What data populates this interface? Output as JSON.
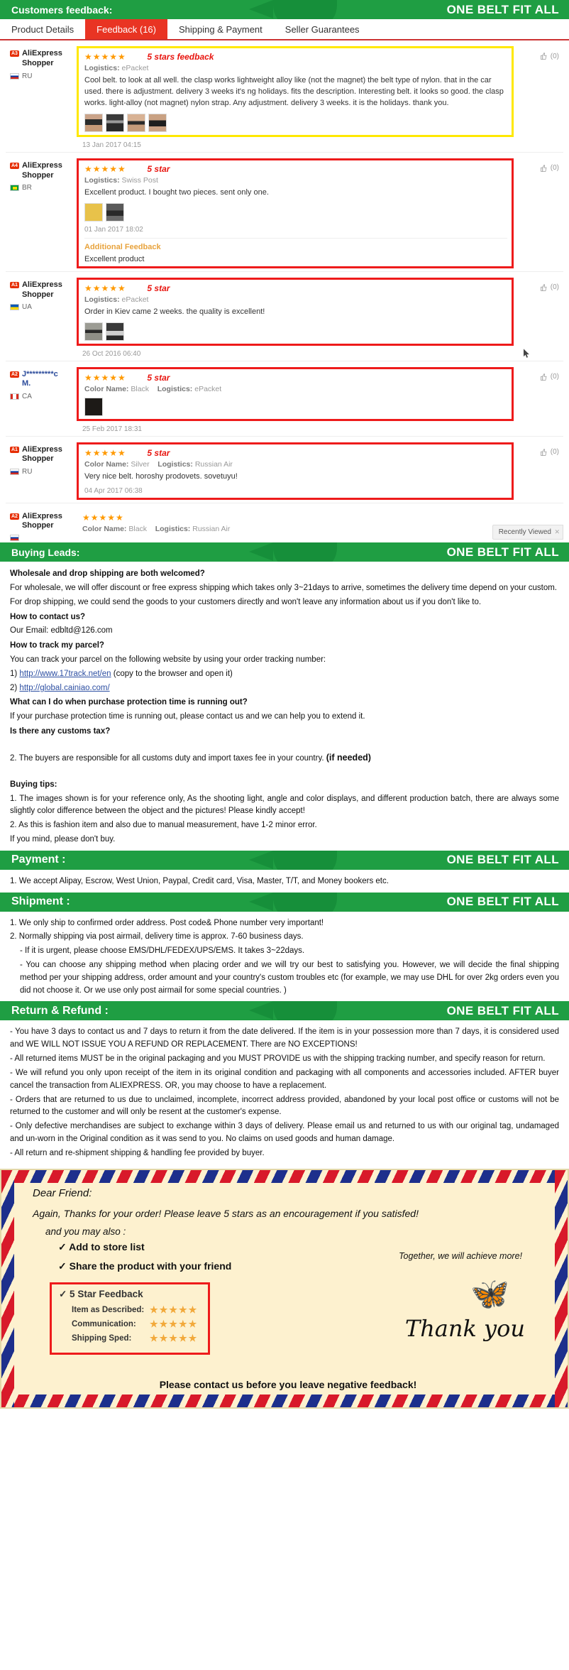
{
  "banners": {
    "customers_feedback": {
      "title": "Customers feedback:",
      "slogan": "ONE BELT FIT ALL"
    },
    "buying_leads": {
      "title": "Buying Leads:",
      "slogan": "ONE BELT FIT ALL"
    },
    "payment": {
      "title": "Payment :",
      "slogan": "ONE BELT FIT ALL"
    },
    "shipment": {
      "title": "Shipment :",
      "slogan": "ONE BELT FIT ALL"
    },
    "return_refund": {
      "title": "Return & Refund :",
      "slogan": "ONE BELT FIT ALL"
    }
  },
  "tabs": [
    {
      "label": "Product Details",
      "active": false
    },
    {
      "label": "Feedback (16)",
      "active": true
    },
    {
      "label": "Shipping & Payment",
      "active": false
    },
    {
      "label": "Seller Guarantees",
      "active": false
    }
  ],
  "recently_viewed": {
    "label": "Recently Viewed",
    "close": "✕"
  },
  "feedback": [
    {
      "badge": "A3",
      "user_line1": "AliExpress",
      "user_line2": "Shopper",
      "country": "RU",
      "flag": "ru",
      "stars": "★★★★★",
      "annotation": "5 stars feedback",
      "highlight": "yellow",
      "meta_label": "Logistics:",
      "meta_value": "ePacket",
      "color_label": "",
      "color_value": "",
      "comment": "Cool belt. to look at all well. the clasp works lightweight alloy like (not the magnet) the belt type of nylon. that in the car used. there is adjustment. delivery 3 weeks it's ng holidays. fits the description. Interesting belt. it looks so good. the clasp works. light-alloy (not magnet) nylon strap. Any adjustment. delivery 3 weeks. it is the holidays. thank you.",
      "thumbs": 4,
      "date": "13 Jan 2017 04:15",
      "helpful": "(0)",
      "additional": null
    },
    {
      "badge": "A4",
      "user_line1": "AliExpress",
      "user_line2": "Shopper",
      "country": "BR",
      "flag": "br",
      "stars": "★★★★★",
      "annotation": "5 star",
      "highlight": "red",
      "meta_label": "Logistics:",
      "meta_value": "Swiss Post",
      "color_label": "",
      "color_value": "",
      "comment": "Excellent product. I bought two pieces. sent only one.",
      "thumbs": 2,
      "date": "01 Jan 2017 18:02",
      "helpful": "(0)",
      "additional": {
        "title": "Additional Feedback",
        "text": "Excellent product"
      }
    },
    {
      "badge": "A1",
      "user_line1": "AliExpress",
      "user_line2": "Shopper",
      "country": "UA",
      "flag": "ua",
      "stars": "★★★★★",
      "annotation": "5 star",
      "highlight": "red",
      "meta_label": "Logistics:",
      "meta_value": "ePacket",
      "color_label": "",
      "color_value": "",
      "comment": "Order in Kiev came 2 weeks. the quality is excellent!",
      "thumbs": 2,
      "date": "26 Oct 2016 06:40",
      "helpful": "(0)",
      "additional": null
    },
    {
      "badge": "A2",
      "user_line1": "J*********c",
      "user_line2": "M.",
      "country": "CA",
      "flag": "ca",
      "stars": "★★★★★",
      "annotation": "5 star",
      "highlight": "red",
      "meta_label": "Logistics:",
      "meta_value": "ePacket",
      "color_label": "Color Name:",
      "color_value": "Black",
      "comment": "",
      "thumbs": 1,
      "date": "25 Feb 2017 18:31",
      "helpful": "(0)",
      "additional": null
    },
    {
      "badge": "A1",
      "user_line1": "AliExpress",
      "user_line2": "Shopper",
      "country": "RU",
      "flag": "ru",
      "stars": "★★★★★",
      "annotation": "5 star",
      "highlight": "red",
      "meta_label": "Logistics:",
      "meta_value": "Russian Air",
      "color_label": "Color Name:",
      "color_value": "Silver",
      "comment": "Very nice belt. horoshy prodovets. sovetuyu!",
      "thumbs": 0,
      "date": "04 Apr 2017 06:38",
      "helpful": "(0)",
      "additional": null
    },
    {
      "badge": "A2",
      "user_line1": "AliExpress",
      "user_line2": "Shopper",
      "country": "",
      "flag": "ru",
      "stars": "★★★★★",
      "annotation": "",
      "highlight": "none",
      "meta_label": "Logistics:",
      "meta_value": "Russian Air",
      "color_label": "Color Name:",
      "color_value": "Black",
      "comment": "",
      "thumbs": 0,
      "date": "",
      "helpful": "",
      "additional": null
    }
  ],
  "buying_leads": {
    "q1": "Wholesale and drop shipping are both welcomed?",
    "a1a": "For wholesale, we will offer discount or free express shipping which takes only 3~21days to arrive, sometimes the delivery time depend on your custom.",
    "a1b": "For drop shipping, we could send the goods to your customers directly and won't leave any information about us if you don't like to.",
    "q2": "How to contact us?",
    "a2": "Our Email: edbltd@126.com",
    "q3": "How to track my parcel?",
    "a3": "You can track your parcel on the following website by using your order tracking number:",
    "link1_prefix": "1) ",
    "link1": "http://www.17track.net/en",
    "link1_suffix": "(copy to the browser and open it)",
    "link2_prefix": "2) ",
    "link2": "http://global.cainiao.com/",
    "q4": "What can I do when purchase protection time is running out?",
    "a4": "If your purchase protection time is running out, please contact us and we can help you to extend it.",
    "q5": "Is there any customs tax?",
    "a5": "2. The buyers are responsible for all customs duty and import taxes fee in your country.",
    "a5_bold": "(if needed)",
    "tips_title": "Buying tips:",
    "tip1": "1. The images shown is for your reference only, As the shooting light, angle and color displays, and different production batch, there are always some slightly color difference between the object and the pictures! Please kindly accept!",
    "tip2": "2. As this is fashion item and also due to manual measurement, have 1-2 minor error.",
    "tip3": "If you mind, please don't buy."
  },
  "payment": {
    "line1": "1. We accept Alipay, Escrow, West Union, Paypal, Credit card, Visa, Master, T/T, and Money bookers etc."
  },
  "shipment": {
    "line1": "1. We only ship to confirmed order address. Post code& Phone number very important!",
    "line2": "2. Normally shipping via post airmail, delivery time is approx. 7-60 business days.",
    "line3": "- If it is urgent, please choose EMS/DHL/FEDEX/UPS/EMS. It takes 3~22days.",
    "line4": "- You can choose any shipping method when placing order and we will try our best to satisfying you. However, we will decide the final shipping method per your shipping address, order amount and your country's custom troubles etc (for example, we may use DHL for over 2kg orders even you did not choose it. Or we use only post airmail for some special countries. )"
  },
  "return_refund": {
    "l1": "- You have 3 days to contact us and 7 days to return it from the date delivered. If the item is in your possession more than 7 days, it is considered used and WE WILL NOT ISSUE YOU A REFUND OR REPLACEMENT. There are NO EXCEPTIONS!",
    "l2": "- All returned items MUST be in the original packaging and you MUST PROVIDE us with the shipping tracking number, and specify reason for return.",
    "l3": "- We will refund you only upon receipt of the item in its original condition and packaging with all components and accessories included. AFTER buyer cancel the transaction from ALIEXPRESS. OR, you may choose to have a replacement.",
    "l4": "- Orders that are returned to us due to unclaimed, incomplete, incorrect address provided, abandoned by your local post office or customs will not be returned to the customer and will only be resent at the customer's expense.",
    "l5": "- Only defective merchandises are subject to exchange within 3 days of delivery. Please email us and returned to us with our original tag, undamaged and un-worn in the Original condition as it was send to you. No claims on used goods and human damage.",
    "l6": "- All return and re-shipment shipping & handling fee provided by buyer."
  },
  "envelope": {
    "greeting": "Dear Friend:",
    "thanks": "Again, Thanks for your order! Please leave 5 stars as an encouragement if you satisfed!",
    "also": "and you may also :",
    "check1": "✓ Add to store list",
    "check2": "✓ Share the product with your friend",
    "together": "Together, we will achieve more!",
    "star_box_title": "✓ 5 Star Feedback",
    "rating_rows": [
      {
        "label": "Item as Described:",
        "stars": "★★★★★"
      },
      {
        "label": "Communication:",
        "stars": "★★★★★"
      },
      {
        "label": "Shipping Sped:",
        "stars": "★★★★★"
      }
    ],
    "thank_you": "Thank you",
    "footer": "Please contact us before you leave negative feedback!"
  },
  "colors": {
    "green": "#1f9e43",
    "red_tab": "#e93423",
    "star_orange": "#ff9900",
    "highlight_yellow": "#ffe800",
    "highlight_red": "#ee1b1b"
  }
}
